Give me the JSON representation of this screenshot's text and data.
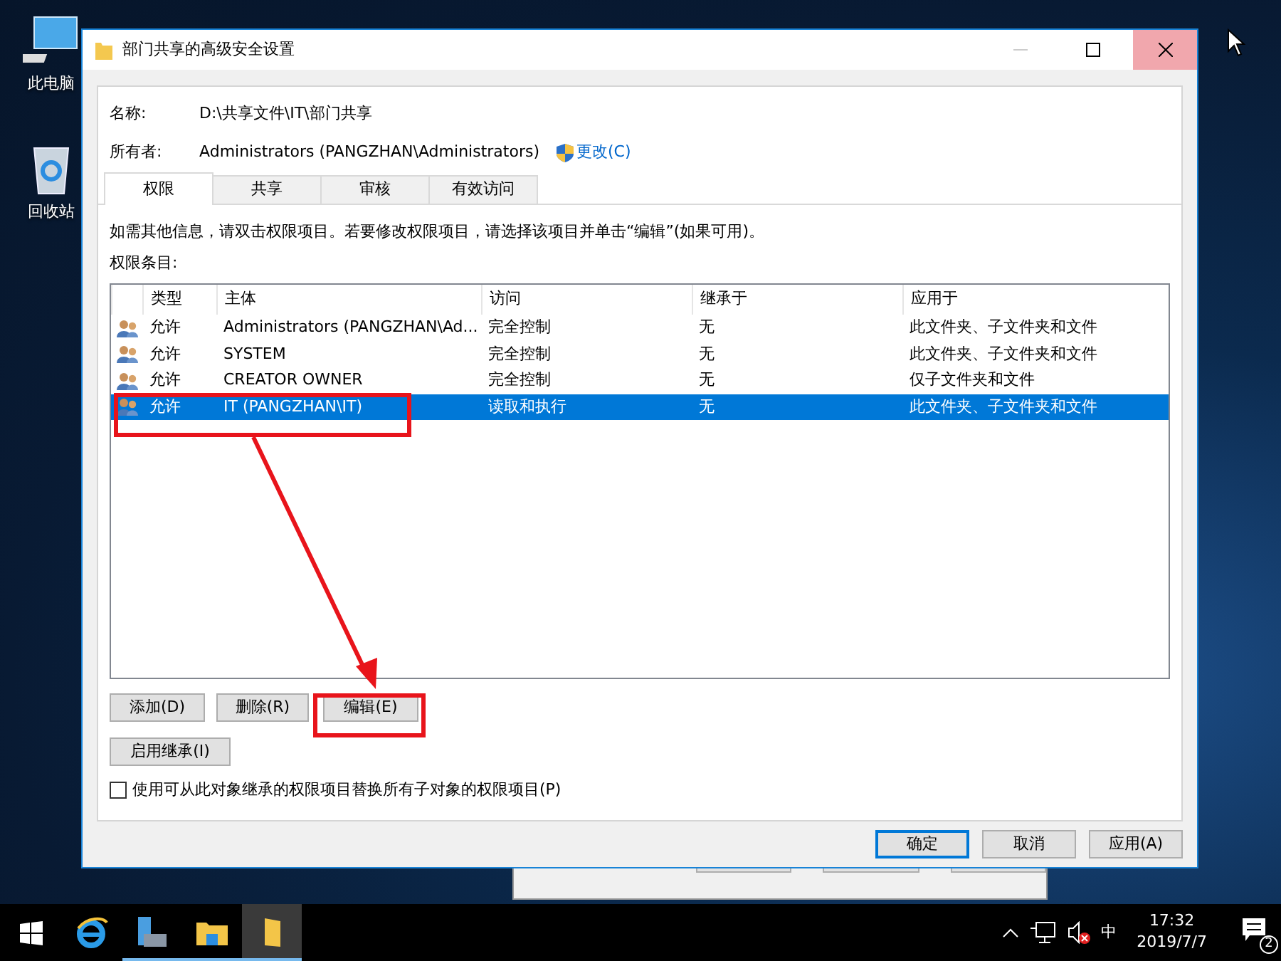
{
  "desktop_icons": [
    {
      "label": "此电脑",
      "kind": "computer"
    },
    {
      "label": "回收站",
      "kind": "recycle"
    }
  ],
  "window": {
    "title": "部门共享的高级安全设置"
  },
  "name": {
    "label": "名称:",
    "value": "D:\\共享文件\\IT\\部门共享"
  },
  "owner": {
    "label": "所有者:",
    "value": "Administrators (PANGZHAN\\Administrators)",
    "link": "更改(C)"
  },
  "tabs": [
    {
      "label": "权限",
      "selected": true
    },
    {
      "label": "共享",
      "selected": false
    },
    {
      "label": "审核",
      "selected": false
    },
    {
      "label": "有效访问",
      "selected": false
    }
  ],
  "info": "如需其他信息，请双击权限项目。若要修改权限项目，请选择该项目并单击“编辑”(如果可用)。",
  "entries_label": "权限条目:",
  "table": {
    "columns": [
      "类型",
      "主体",
      "访问",
      "继承于",
      "应用于"
    ],
    "rows": [
      {
        "cells": [
          "允许",
          "Administrators (PANGZHAN\\Ad...",
          "完全控制",
          "无",
          "此文件夹、子文件夹和文件"
        ],
        "selected": false
      },
      {
        "cells": [
          "允许",
          "SYSTEM",
          "完全控制",
          "无",
          "此文件夹、子文件夹和文件"
        ],
        "selected": false
      },
      {
        "cells": [
          "允许",
          "CREATOR OWNER",
          "完全控制",
          "无",
          "仅子文件夹和文件"
        ],
        "selected": false
      },
      {
        "cells": [
          "允许",
          "IT (PANGZHAN\\IT)",
          "读取和执行",
          "无",
          "此文件夹、子文件夹和文件"
        ],
        "selected": true
      }
    ]
  },
  "row_buttons": [
    "添加(D)",
    "删除(R)",
    "编辑(E)"
  ],
  "inherit_button": "启用继承(I)",
  "replace_checkbox": {
    "label": "使用可从此对象继承的权限项目替换所有子对象的权限项目(P)",
    "checked": false
  },
  "footer_buttons": [
    {
      "label": "确定",
      "default": true
    },
    {
      "label": "取消",
      "default": false
    },
    {
      "label": "应用(A)",
      "default": false
    }
  ],
  "annotations": [
    {
      "kind": "box"
    },
    {
      "kind": "box"
    },
    {
      "kind": "arrow"
    }
  ],
  "taskbar": {
    "apps": [
      {
        "kind": "start",
        "running": false,
        "active": false
      },
      {
        "kind": "browser",
        "running": false,
        "active": false
      },
      {
        "kind": "server",
        "running": true,
        "active": false
      },
      {
        "kind": "explorer",
        "running": true,
        "active": false
      },
      {
        "kind": "folder",
        "running": true,
        "active": true
      }
    ],
    "ime": "中",
    "time": "17:32",
    "date": "2019/7/7",
    "notifications": "2"
  }
}
